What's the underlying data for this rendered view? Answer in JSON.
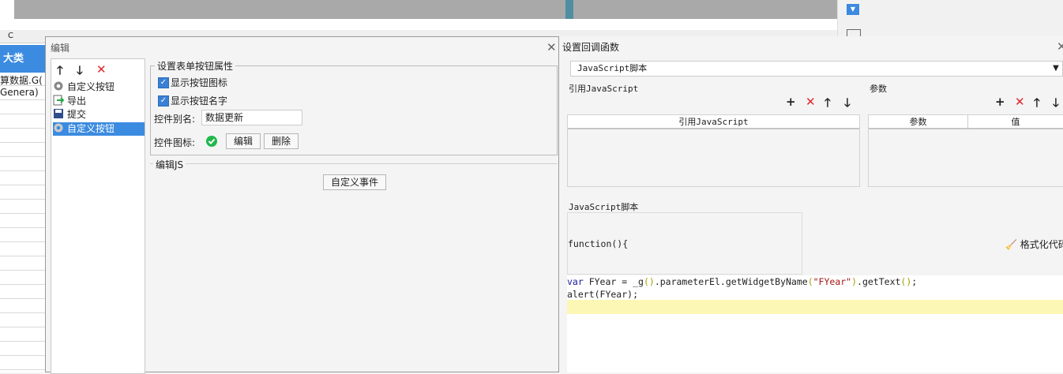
{
  "background": {
    "column_c": "C",
    "header_cell": "大类",
    "cell_formula": "算数据.G(",
    "cell_general": "Genera)"
  },
  "edit_dialog": {
    "title": "编辑",
    "toolbar": {
      "up_icon": "arrow-up-icon",
      "down_icon": "arrow-down-icon",
      "delete_icon": "delete-icon"
    },
    "tree_items": [
      {
        "label": "自定义按钮",
        "icon": "gear-icon"
      },
      {
        "label": "导出",
        "icon": "export-icon"
      },
      {
        "label": "提交",
        "icon": "save-icon"
      },
      {
        "label": "自定义按钮",
        "icon": "gear-icon",
        "selected": true
      }
    ],
    "props_legend": "设置表单按钮属性",
    "show_icon_label": "显示按钮图标",
    "show_name_label": "显示按钮名字",
    "alias_label": "控件别名:",
    "alias_value": "数据更新",
    "icon_label": "控件图标:",
    "edit_button": "编辑",
    "delete_button": "删除",
    "js_legend": "编辑JS",
    "custom_event_button": "自定义事件"
  },
  "callback_dialog": {
    "title": "设置回调函数",
    "script_type": "JavaScript脚本",
    "ref_js_label": "引用JavaScript",
    "params_label": "参数",
    "ref_js_column": "引用JavaScript",
    "param_columns": [
      "参数",
      "值"
    ],
    "script_label": "JavaScript脚本",
    "function_header": "function(){",
    "format_button": "格式化代码",
    "code": {
      "line1_var": "var",
      "line1_rest_a": " FYear = _g",
      "line1_paren1": "()",
      "line1_rest_b": ".parameterEl.getWidgetByName",
      "line1_paren2": "(",
      "line1_str": "\"FYear\"",
      "line1_paren3": ")",
      "line1_rest_c": ".getText",
      "line1_paren4": "()",
      "line1_end": ";",
      "line2": "alert(FYear);"
    }
  },
  "colors": {
    "accent": "#3b8be0",
    "delete": "#e0252b",
    "highlight": "#fcf7b5",
    "check": "#1fb84c"
  }
}
